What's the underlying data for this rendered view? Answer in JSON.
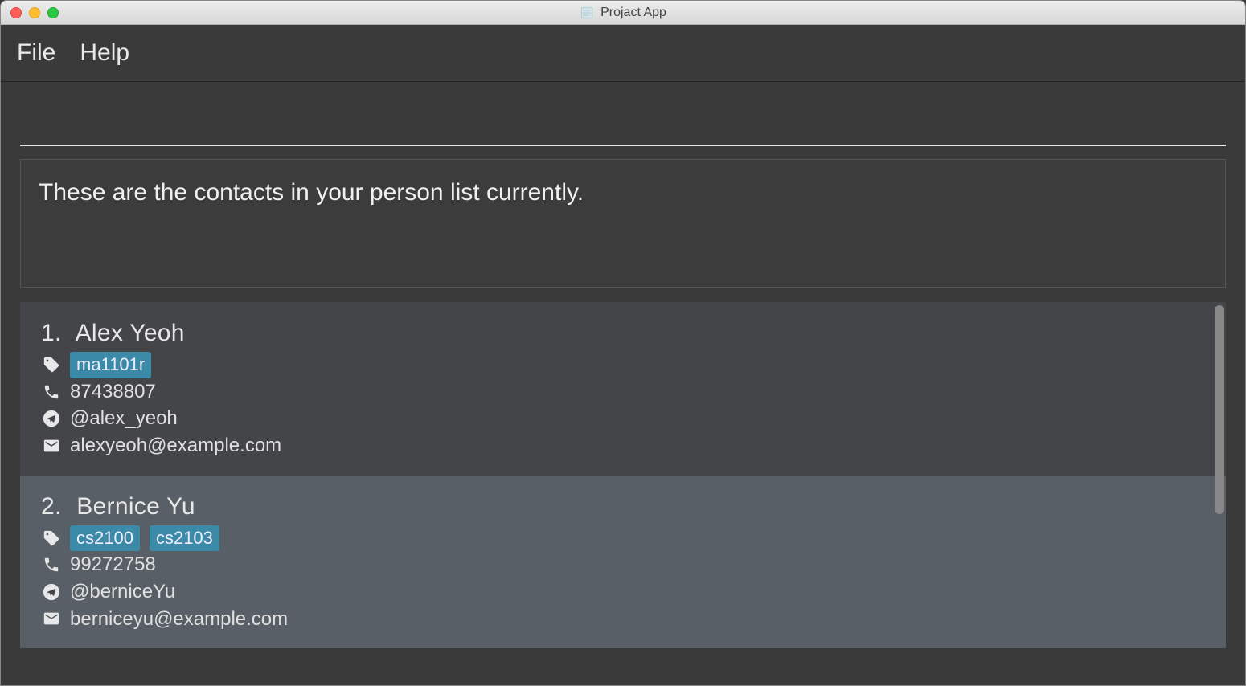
{
  "window": {
    "title": "Projact App"
  },
  "menu": {
    "file": "File",
    "help": "Help"
  },
  "command": {
    "value": ""
  },
  "result": {
    "message": "These are the contacts in your person list currently."
  },
  "contacts": [
    {
      "index": "1.",
      "name": "Alex Yeoh",
      "tags": [
        "ma1101r"
      ],
      "phone": "87438807",
      "telegram": "@alex_yeoh",
      "email": "alexyeoh@example.com"
    },
    {
      "index": "2.",
      "name": "Bernice Yu",
      "tags": [
        "cs2100",
        "cs2103"
      ],
      "phone": "99272758",
      "telegram": "@berniceYu",
      "email": "berniceyu@example.com"
    }
  ]
}
